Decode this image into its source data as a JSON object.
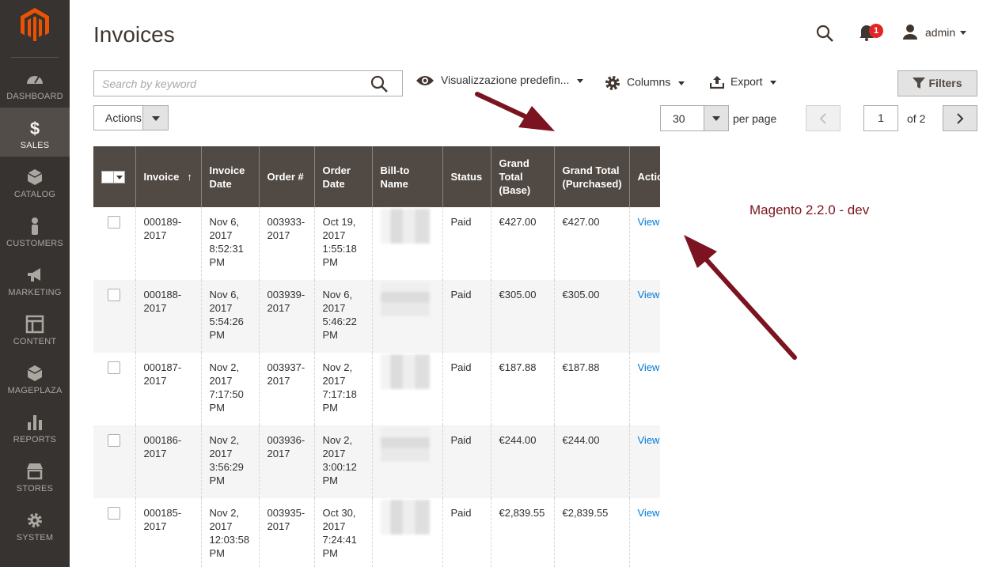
{
  "sidebar": {
    "items": [
      {
        "label": "DASHBOARD",
        "icon": "dashboard-icon"
      },
      {
        "label": "SALES",
        "icon": "dollar-icon"
      },
      {
        "label": "CATALOG",
        "icon": "cube-icon"
      },
      {
        "label": "CUSTOMERS",
        "icon": "person-icon"
      },
      {
        "label": "MARKETING",
        "icon": "megaphone-icon"
      },
      {
        "label": "CONTENT",
        "icon": "layout-icon"
      },
      {
        "label": "MAGEPLAZA",
        "icon": "cube-icon"
      },
      {
        "label": "REPORTS",
        "icon": "bar-chart-icon"
      },
      {
        "label": "STORES",
        "icon": "store-icon"
      },
      {
        "label": "SYSTEM",
        "icon": "gear-icon"
      }
    ],
    "active": "SALES"
  },
  "header": {
    "title": "Invoices",
    "notification_count": "1",
    "user": "admin"
  },
  "toolbar": {
    "search_placeholder": "Search by keyword",
    "view_label": "Visualizzazione predefin...",
    "columns_label": "Columns",
    "export_label": "Export",
    "filters_label": "Filters",
    "actions_label": "Actions",
    "per_page_value": "30",
    "per_page_label": "per page",
    "page_value": "1",
    "page_of": "of 2"
  },
  "grid": {
    "headers": [
      "Invoice",
      "Invoice Date",
      "Order #",
      "Order Date",
      "Bill-to Name",
      "Status",
      "Grand Total (Base)",
      "Grand Total (Purchased)",
      "Action"
    ],
    "sort_indicator": "↑",
    "rows": [
      {
        "invoice": "000189-2017",
        "invoice_date": "Nov 6, 2017 8:52:31 PM",
        "order": "003933-2017",
        "order_date": "Oct 19, 2017 1:55:18 PM",
        "status": "Paid",
        "gt_base": "€427.00",
        "gt_purchased": "€427.00",
        "action": "View"
      },
      {
        "invoice": "000188-2017",
        "invoice_date": "Nov 6, 2017 5:54:26 PM",
        "order": "003939-2017",
        "order_date": "Nov 6, 2017 5:46:22 PM",
        "status": "Paid",
        "gt_base": "€305.00",
        "gt_purchased": "€305.00",
        "action": "View"
      },
      {
        "invoice": "000187-2017",
        "invoice_date": "Nov 2, 2017 7:17:50 PM",
        "order": "003937-2017",
        "order_date": "Nov 2, 2017 7:17:18 PM",
        "status": "Paid",
        "gt_base": "€187.88",
        "gt_purchased": "€187.88",
        "action": "View"
      },
      {
        "invoice": "000186-2017",
        "invoice_date": "Nov 2, 2017 3:56:29 PM",
        "order": "003936-2017",
        "order_date": "Nov 2, 2017 3:00:12 PM",
        "status": "Paid",
        "gt_base": "€244.00",
        "gt_purchased": "€244.00",
        "action": "View"
      },
      {
        "invoice": "000185-2017",
        "invoice_date": "Nov 2, 2017 12:03:58 PM",
        "order": "003935-2017",
        "order_date": "Oct 30, 2017 7:24:41 PM",
        "status": "Paid",
        "gt_base": "€2,839.55",
        "gt_purchased": "€2,839.55",
        "action": "View"
      }
    ]
  },
  "annotation": {
    "text": "Magento 2.2.0 - dev",
    "color": "#7b1420"
  },
  "colors": {
    "sidebar_bg": "#373330",
    "sidebar_active": "#524d49",
    "logo": "#eb5202",
    "header_bg": "#514943",
    "link": "#007bdb",
    "badge": "#e22626"
  }
}
